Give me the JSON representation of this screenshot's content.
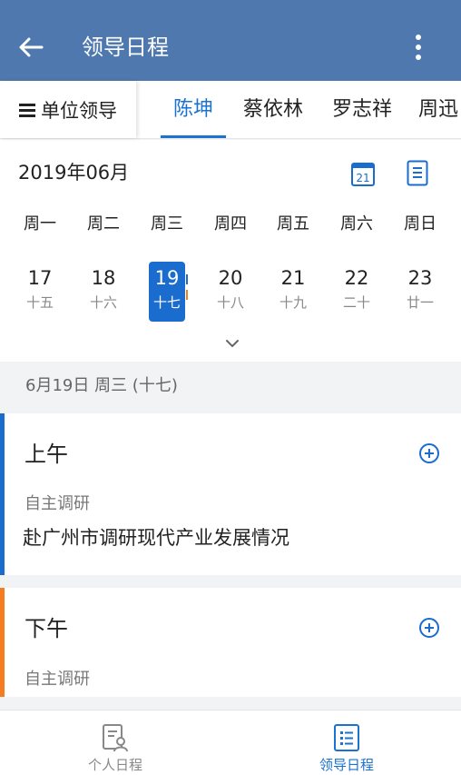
{
  "app_bar": {
    "title": "领导日程",
    "background": "#4f79ae"
  },
  "leader_bar": {
    "unit_label": "单位领导",
    "tabs": [
      {
        "label": "陈坤",
        "active": true
      },
      {
        "label": "蔡依林",
        "active": false
      },
      {
        "label": "罗志祥",
        "active": false
      },
      {
        "label": "周迅",
        "active": false
      }
    ],
    "accent": "#1a73d1"
  },
  "calendar": {
    "month_label": "2019年06月",
    "calendar_icon_day": "21",
    "weekdays": [
      "周一",
      "周二",
      "周三",
      "周四",
      "周五",
      "周六",
      "周日"
    ],
    "days": [
      {
        "day": "17",
        "lunar": "十五"
      },
      {
        "day": "18",
        "lunar": "十六"
      },
      {
        "day": "19",
        "lunar": "十七",
        "selected": true
      },
      {
        "day": "20",
        "lunar": "十八"
      },
      {
        "day": "21",
        "lunar": "十九"
      },
      {
        "day": "22",
        "lunar": "二十"
      },
      {
        "day": "23",
        "lunar": "廿一"
      }
    ],
    "event_marker_colors": [
      "#1a6ccf",
      "#f0821e"
    ]
  },
  "selected_date_label": "6月19日 周三 (十七)",
  "schedule": {
    "morning": {
      "period": "上午",
      "category": "自主调研",
      "content": "赴广州市调研现代产业发展情况",
      "stripe_color": "#1a6ccf"
    },
    "afternoon": {
      "period": "下午",
      "category": "自主调研",
      "stripe_color": "#f57c1f"
    }
  },
  "bottom_nav": {
    "items": [
      {
        "label": "个人日程",
        "icon": "personal-schedule-icon",
        "active": false
      },
      {
        "label": "领导日程",
        "icon": "leader-schedule-icon",
        "active": true
      }
    ],
    "active_color": "#1a73d1",
    "inactive_color": "#888888"
  }
}
